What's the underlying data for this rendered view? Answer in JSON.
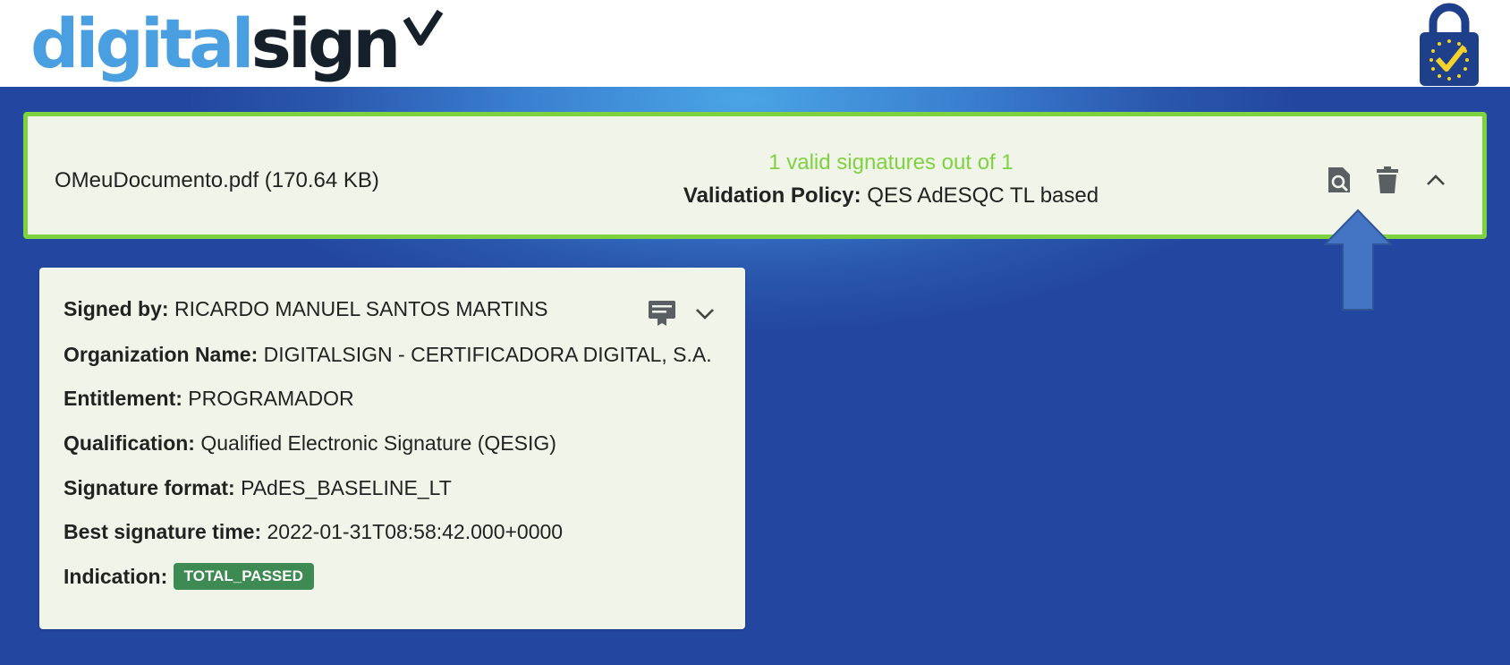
{
  "header": {
    "logo_text_1": "digital",
    "logo_text_2": "sign"
  },
  "document": {
    "filename": "OMeuDocumento.pdf (170.64 KB)",
    "valid_text": "1 valid signatures out of 1",
    "policy_label": "Validation Policy:",
    "policy_value": " QES AdESQC TL based",
    "actions": [
      "document-search-icon",
      "trash-icon",
      "chevron-up-icon"
    ]
  },
  "signature": {
    "signed_by_label": "Signed by:",
    "signed_by_value": " RICARDO MANUEL SANTOS MARTINS",
    "org_label": "Organization Name:",
    "org_value": " DIGITALSIGN - CERTIFICADORA DIGITAL, S.A.",
    "entitlement_label": "Entitlement:",
    "entitlement_value": " PROGRAMADOR",
    "qualification_label": "Qualification:",
    "qualification_value": " Qualified Electronic Signature (QESIG)",
    "format_label": "Signature format:",
    "format_value": " PAdES_BASELINE_LT",
    "time_label": "Best signature time:",
    "time_value": " 2022-01-31T08:58:42.000+0000",
    "indication_label": "Indication:",
    "indication_value": "TOTAL_PASSED"
  },
  "colors": {
    "valid_green": "#7ed23f",
    "badge_green": "#3d8b52",
    "logo_blue": "#4a9fe0",
    "card_bg": "#f1f5e9",
    "background_blue": "#2347a0"
  }
}
